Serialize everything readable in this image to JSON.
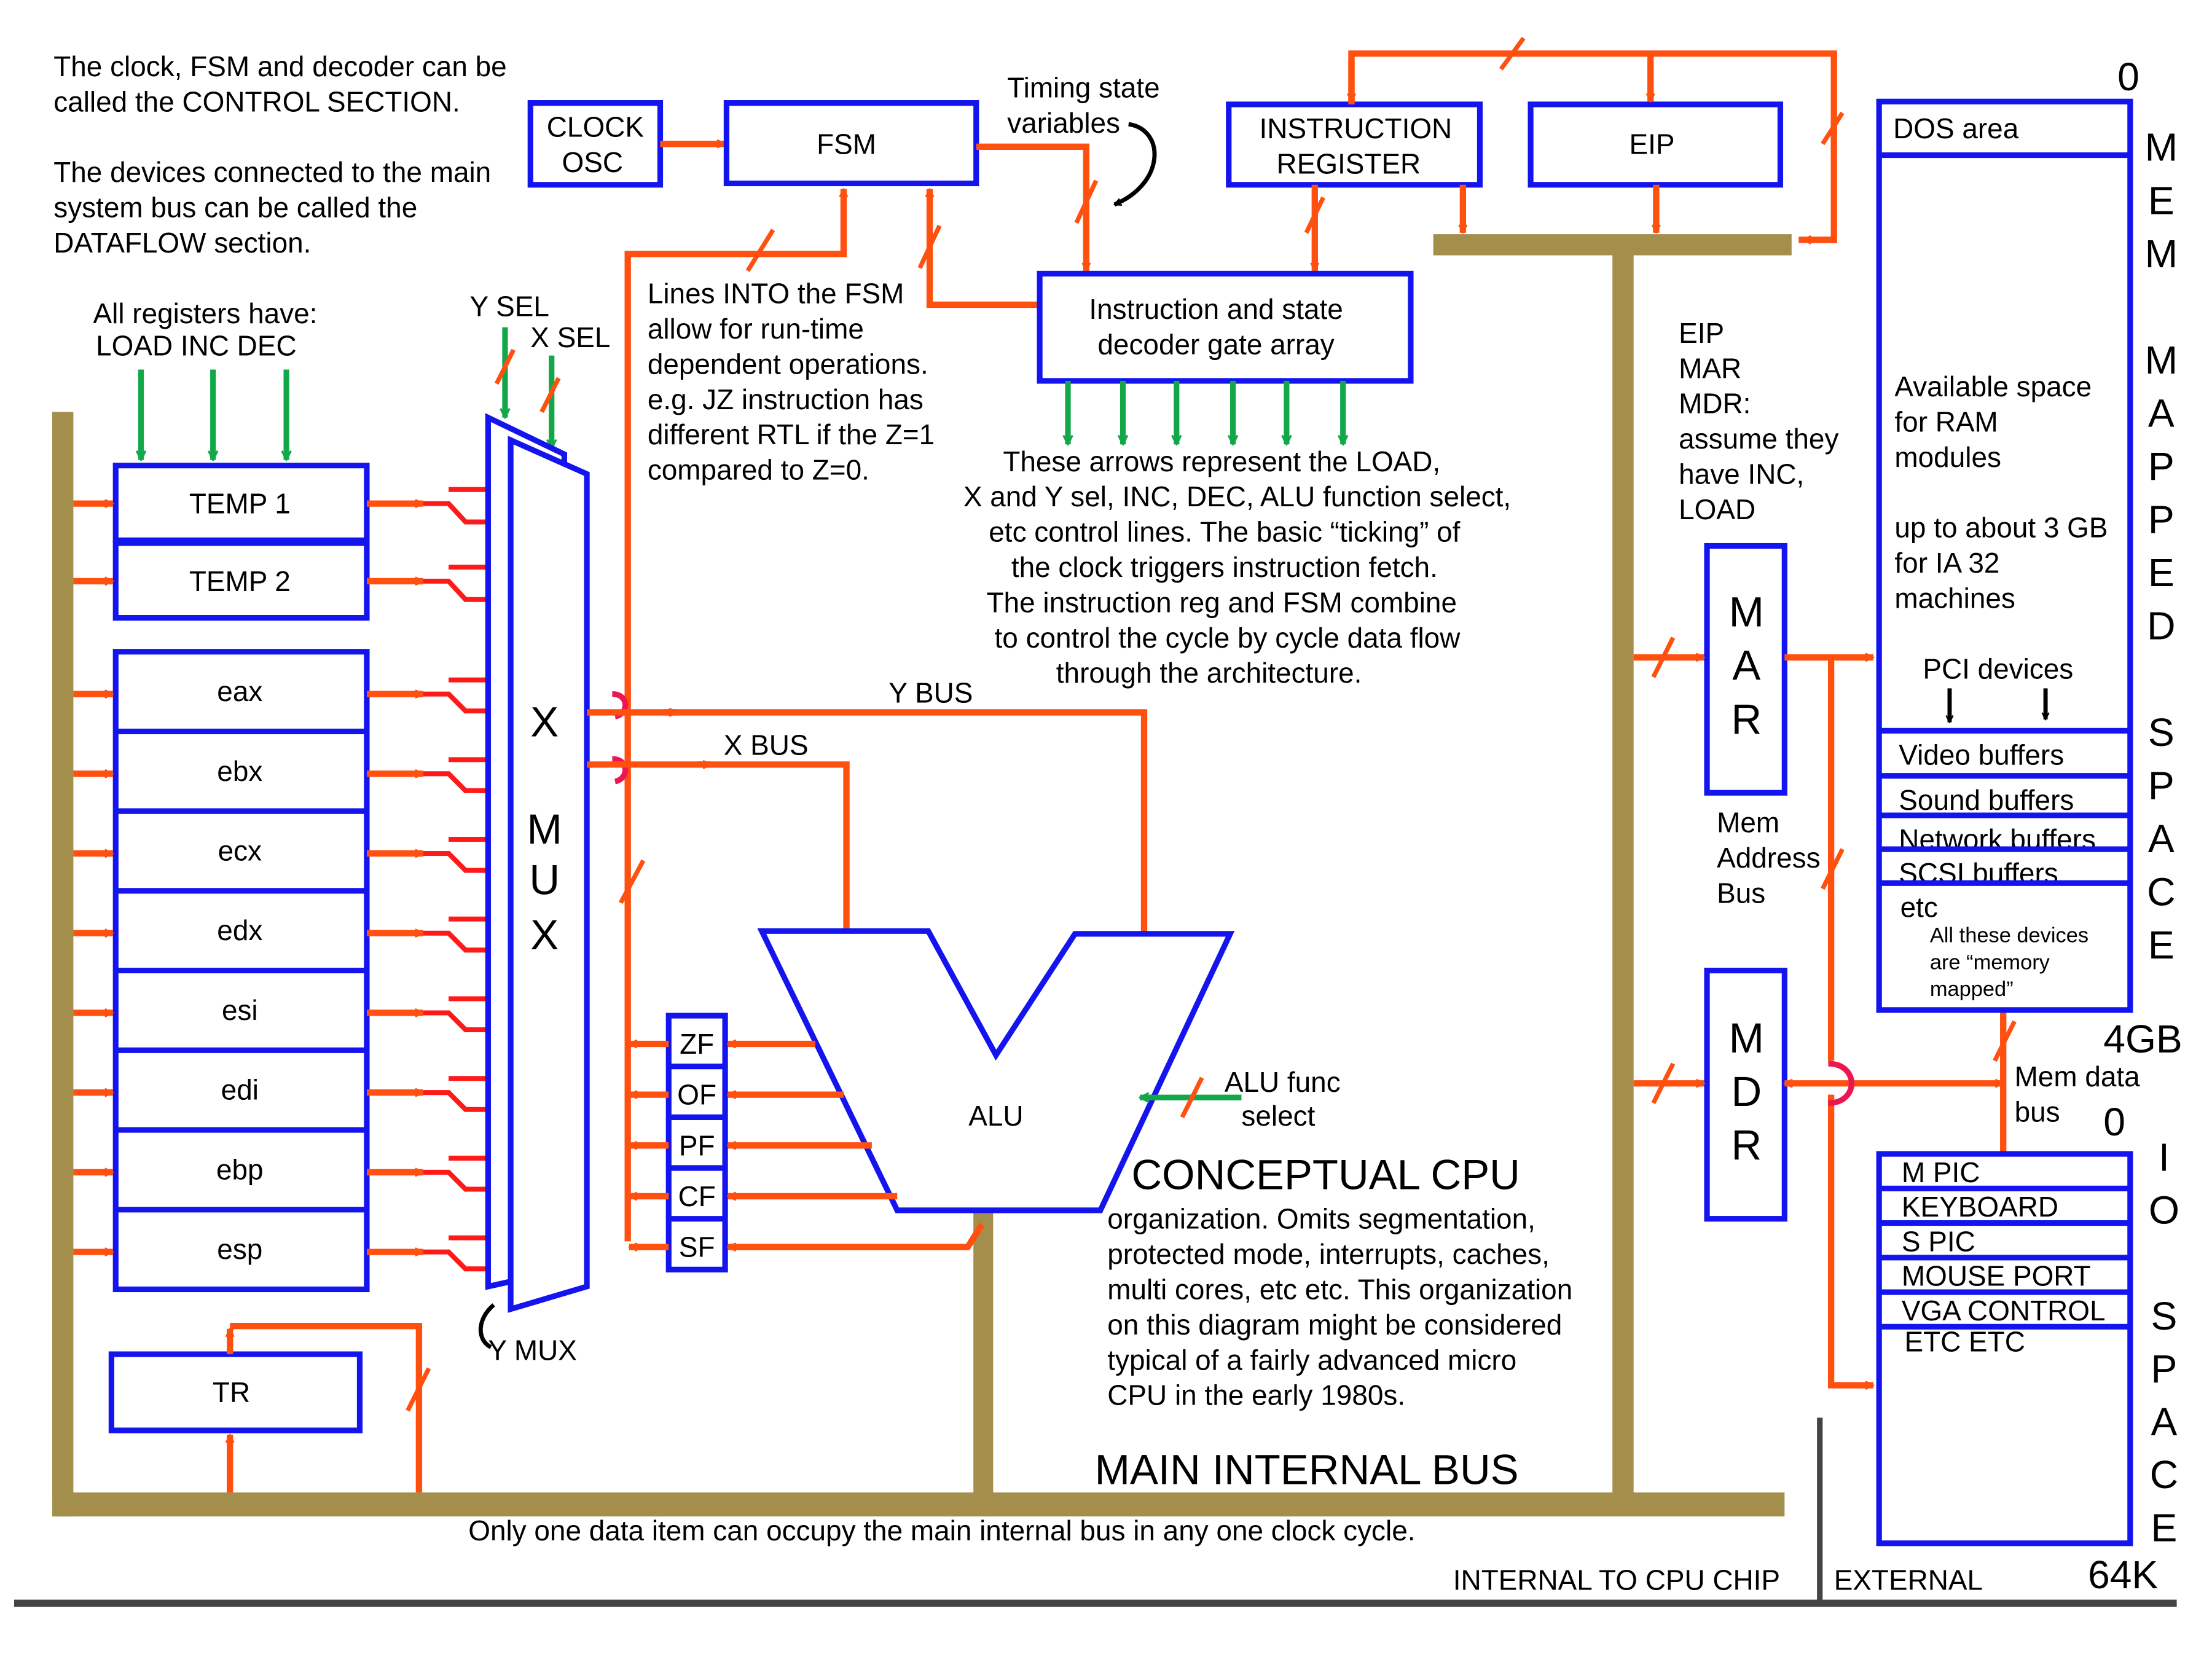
{
  "notes": {
    "control_section": [
      "The clock, FSM and decoder can be",
      "called the CONTROL SECTION."
    ],
    "dataflow_section": [
      "The devices connected to the main",
      "system bus can be called the",
      "DATAFLOW section."
    ],
    "all_registers": [
      "All registers have:",
      "LOAD  INC  DEC"
    ],
    "timing_state": [
      "Timing state",
      "variables"
    ],
    "lines_into_fsm": [
      "Lines INTO the FSM",
      "allow for run-time",
      "dependent operations.",
      "e.g. JZ instruction has",
      "different RTL if the Z=1",
      "compared to Z=0."
    ],
    "control_arrows": [
      "These arrows represent the LOAD,",
      "X and Y sel, INC, DEC, ALU function select,",
      "etc control lines. The basic “ticking” of",
      "the clock triggers instruction fetch.",
      "The instruction reg and FSM combine",
      "to control the cycle by cycle data flow",
      "through the architecture."
    ],
    "eip_mar_mdr": [
      "EIP",
      "MAR",
      "MDR:",
      "assume they",
      "have INC,",
      "LOAD"
    ],
    "conceptual_title": "CONCEPTUAL CPU",
    "conceptual_body": [
      "organization. Omits segmentation,",
      "protected  mode, interrupts, caches,",
      "multi cores, etc etc. This organization",
      "on this diagram might be considered",
      "typical of a fairly advanced micro",
      "CPU in the early 1980s."
    ],
    "main_bus_title": "MAIN INTERNAL BUS",
    "main_bus_note": "Only one data item can occupy the main internal bus in any one clock cycle.",
    "internal_label": "INTERNAL TO CPU CHIP",
    "external_label": "EXTERNAL"
  },
  "control": {
    "clock": [
      "CLOCK",
      "OSC"
    ],
    "fsm": "FSM",
    "instruction_register": [
      "INSTRUCTION",
      "REGISTER"
    ],
    "eip": "EIP",
    "decoder": [
      "Instruction and state",
      "decoder gate array"
    ]
  },
  "registers": {
    "temp": [
      "TEMP 1",
      "TEMP 2"
    ],
    "general": [
      "eax",
      "ebx",
      "ecx",
      "edx",
      "esi",
      "edi",
      "ebp",
      "esp"
    ],
    "tr": "TR"
  },
  "mux": {
    "y_sel": "Y SEL",
    "x_sel": "X SEL",
    "x_mux_letters": [
      "X",
      "M",
      "U",
      "X"
    ],
    "y_mux": "Y MUX"
  },
  "buses": {
    "y_bus": "Y BUS",
    "x_bus": "X BUS",
    "mem_address_bus": [
      "Mem",
      "Address",
      "Bus"
    ],
    "mem_data_bus": [
      "Mem data",
      "bus"
    ]
  },
  "alu": {
    "label": "ALU",
    "func_select": [
      "ALU func",
      "select"
    ],
    "flags": [
      "ZF",
      "OF",
      "PF",
      "CF",
      "SF"
    ]
  },
  "memory_interface": {
    "mar": [
      "M",
      "A",
      "R"
    ],
    "mdr": [
      "M",
      "D",
      "R"
    ]
  },
  "mem_space": {
    "start": "0",
    "end": "4GB",
    "side_label": [
      "M",
      "E",
      "M",
      "",
      "M",
      "A",
      "P",
      "P",
      "E",
      "D",
      "",
      "S",
      "P",
      "A",
      "C",
      "E"
    ],
    "dos_area": "DOS area",
    "available": [
      "Available space",
      "for RAM",
      "modules",
      "",
      "up to about 3 GB",
      "for IA 32",
      "machines"
    ],
    "pci_devices": "PCI devices",
    "buffers": [
      "Video buffers",
      "Sound buffers",
      "Network buffers",
      "SCSI buffers"
    ],
    "etc": "etc",
    "memory_mapped_note": [
      "All these devices",
      "are “memory",
      "mapped”"
    ]
  },
  "io_space": {
    "start": "0",
    "end": "64K",
    "side_label": [
      "I",
      "O",
      "",
      "S",
      "P",
      "A",
      "C",
      "E"
    ],
    "devices": [
      "M PIC",
      "KEYBOARD",
      "S PIC",
      "MOUSE PORT",
      "VGA CONTROL"
    ],
    "etc": "ETC ETC"
  },
  "colors": {
    "box_border": "#1414ee",
    "data_line": "#ff5010",
    "control_line": "#12a84a",
    "main_bus": "#a38f4b",
    "chip_boundary": "#444444"
  }
}
